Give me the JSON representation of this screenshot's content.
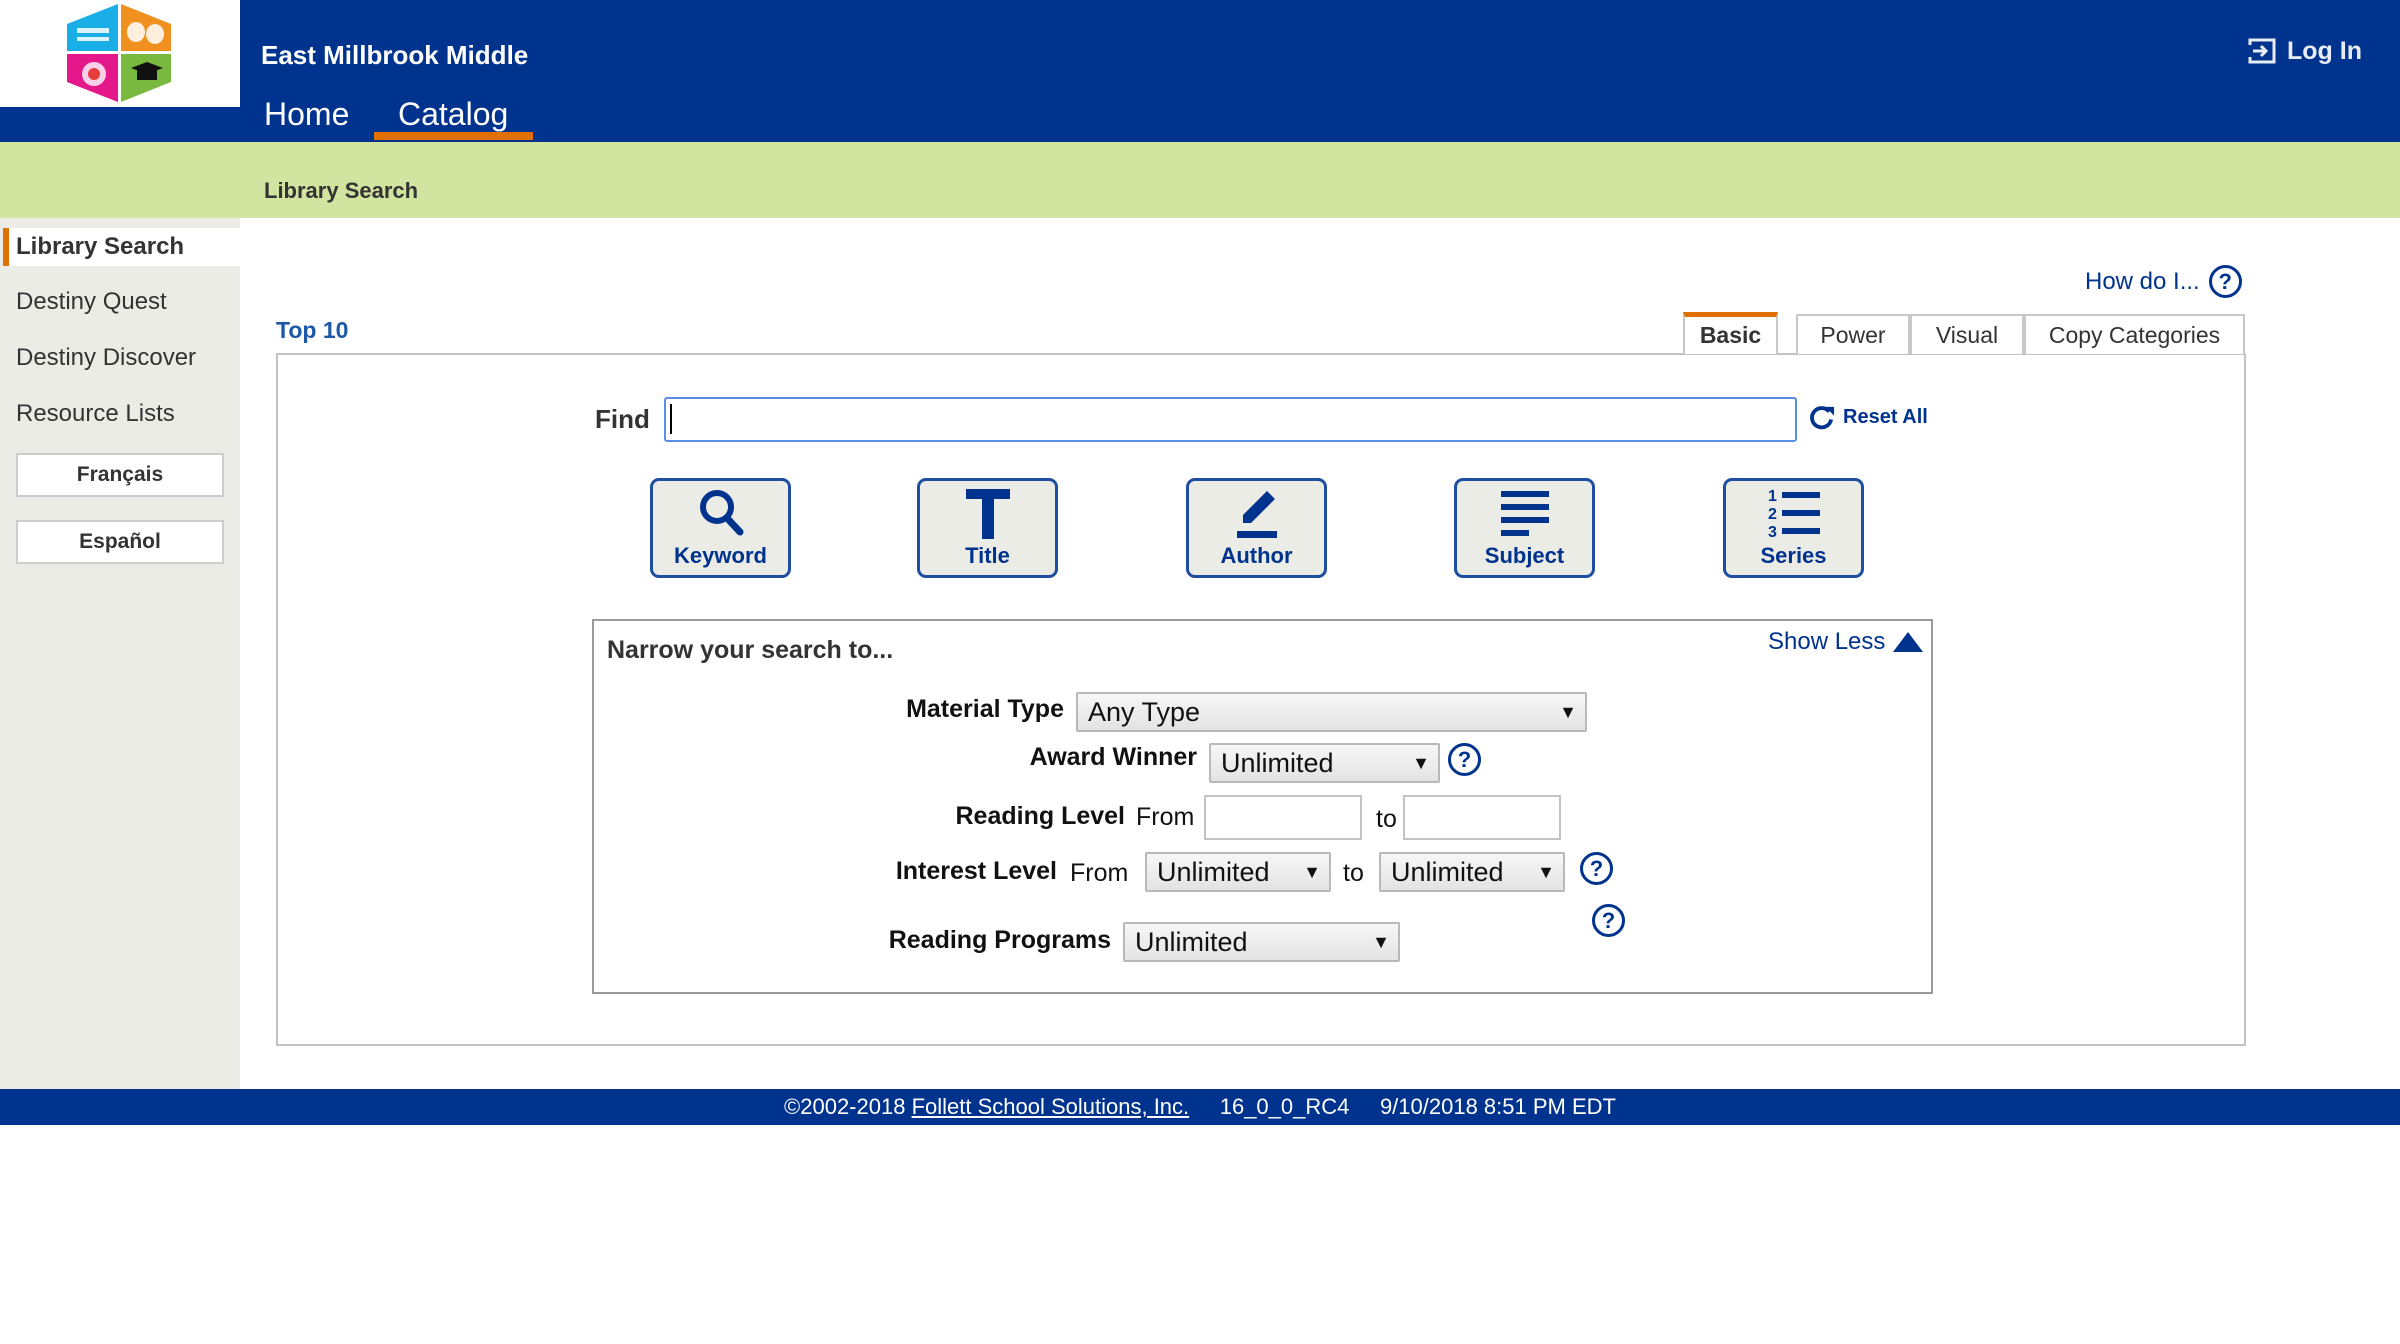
{
  "header": {
    "school_name": "East Millbrook Middle",
    "nav": [
      {
        "label": "Home",
        "active": false
      },
      {
        "label": "Catalog",
        "active": true
      }
    ],
    "login_label": "Log In",
    "brand_color": "#00338d",
    "accent_color": "#e07000"
  },
  "breadcrumb": "Library Search",
  "sidebar": {
    "items": [
      {
        "label": "Library Search",
        "active": true
      },
      {
        "label": "Destiny Quest",
        "active": false
      },
      {
        "label": "Destiny Discover",
        "active": false
      },
      {
        "label": "Resource Lists",
        "active": false
      }
    ],
    "language_buttons": [
      "Français",
      "Español"
    ]
  },
  "help_link": "How do I...",
  "help_glyph": "?",
  "top10_link": "Top 10",
  "tabs": [
    {
      "label": "Basic",
      "active": true
    },
    {
      "label": "Power",
      "active": false
    },
    {
      "label": "Visual",
      "active": false
    },
    {
      "label": "Copy Categories",
      "active": false
    }
  ],
  "search": {
    "find_label": "Find",
    "find_value": "",
    "reset_label": "Reset All",
    "buttons": [
      {
        "label": "Keyword",
        "icon": "magnifier-icon"
      },
      {
        "label": "Title",
        "icon": "letter-t-icon"
      },
      {
        "label": "Author",
        "icon": "pencil-icon"
      },
      {
        "label": "Subject",
        "icon": "lines-icon"
      },
      {
        "label": "Series",
        "icon": "numbered-list-icon"
      }
    ]
  },
  "narrow": {
    "title": "Narrow your search to...",
    "toggle_label": "Show Less",
    "material_type": {
      "label": "Material Type",
      "value": "Any Type"
    },
    "award_winner": {
      "label": "Award Winner",
      "value": "Unlimited"
    },
    "reading_level": {
      "label": "Reading Level",
      "from_label": "From",
      "to_label": "to",
      "from_value": "",
      "to_value": ""
    },
    "interest_level": {
      "label": "Interest Level",
      "from_label": "From",
      "to_label": "to",
      "from_value": "Unlimited",
      "to_value": "Unlimited"
    },
    "reading_programs": {
      "label": "Reading Programs",
      "value": "Unlimited"
    },
    "arrow_glyph": "▼"
  },
  "footer": {
    "copyright": "©2002-2018 ",
    "company_link": "Follett School Solutions, Inc.",
    "version": "     16_0_0_RC4     ",
    "timestamp": "9/10/2018 8:51 PM EDT"
  }
}
